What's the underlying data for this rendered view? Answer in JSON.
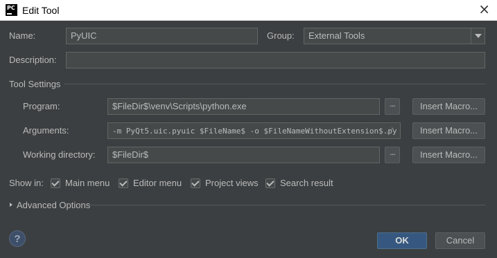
{
  "window": {
    "title": "Edit Tool",
    "app_icon": "PC"
  },
  "form": {
    "name_label": "Name:",
    "name_value": "PyUIC",
    "group_label": "Group:",
    "group_value": "External Tools",
    "description_label": "Description:",
    "description_value": ""
  },
  "tool_settings": {
    "section_label": "Tool Settings",
    "program_label": "Program:",
    "program_value": "$FileDir$\\venv\\Scripts\\python.exe",
    "arguments_label": "Arguments:",
    "arguments_value": "-m PyQt5.uic.pyuic  $FileName$ -o $FileNameWithoutExtension$.py",
    "workdir_label": "Working directory:",
    "workdir_value": "$FileDir$",
    "browse_label": "...",
    "insert_macro_label": "Insert Macro..."
  },
  "show_in": {
    "label": "Show in:",
    "options": [
      {
        "label": "Main menu",
        "checked": true
      },
      {
        "label": "Editor menu",
        "checked": true
      },
      {
        "label": "Project views",
        "checked": true
      },
      {
        "label": "Search result",
        "checked": true
      }
    ]
  },
  "advanced": {
    "label": "Advanced Options"
  },
  "footer": {
    "help_label": "?",
    "ok_label": "OK",
    "cancel_label": "Cancel"
  },
  "colors": {
    "background": "#3c3f41",
    "primary_button": "#365880",
    "field": "#45494a"
  }
}
